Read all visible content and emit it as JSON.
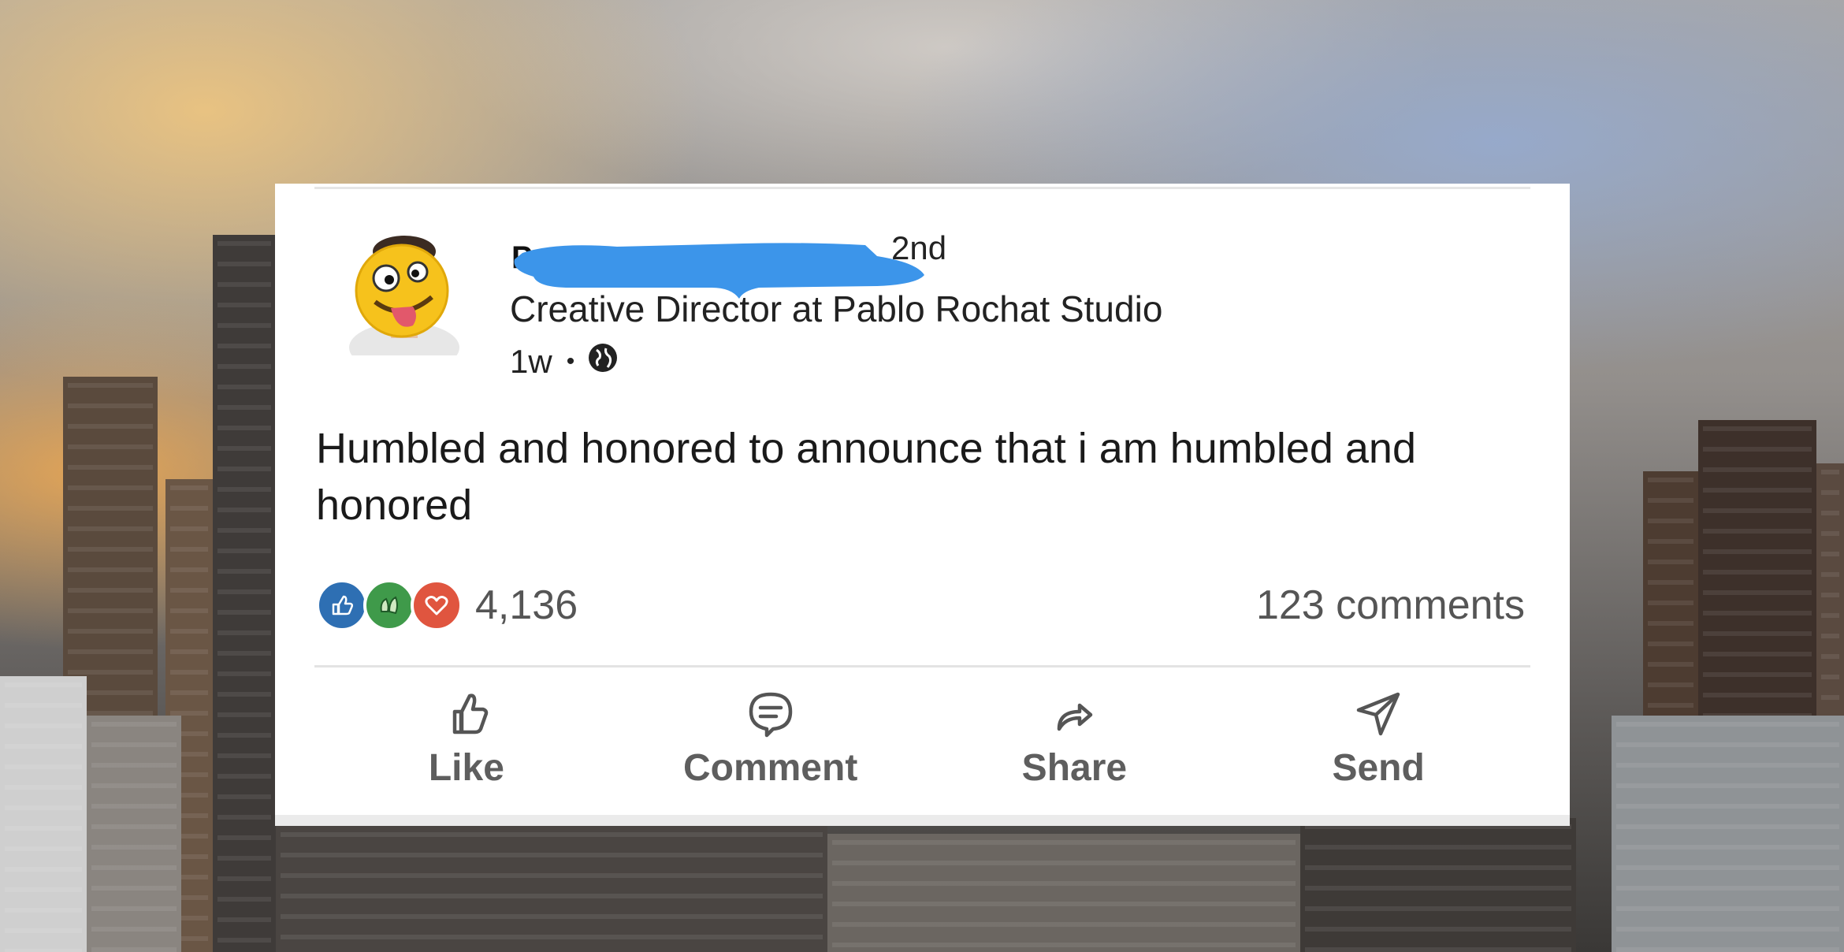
{
  "post": {
    "author_initial": "P",
    "connection_degree": "2nd",
    "headline": "Creative Director at Pablo Rochat Studio",
    "timestamp": "1w",
    "visibility_icon": "globe-icon",
    "text": "Humbled and honored to announce that i am humbled and honored",
    "reaction_icons": [
      "like-reaction-icon",
      "celebrate-reaction-icon",
      "love-reaction-icon"
    ],
    "reaction_count": "4,136",
    "comments_count": "123 comments"
  },
  "actions": {
    "like_label": "Like",
    "comment_label": "Comment",
    "share_label": "Share",
    "send_label": "Send"
  },
  "colors": {
    "redaction_blue": "#3c95ea",
    "like_blue": "#2e6fb3",
    "celebrate_green": "#3f9a4a",
    "love_red": "#e0553f",
    "action_gray": "#5e5e5e"
  }
}
